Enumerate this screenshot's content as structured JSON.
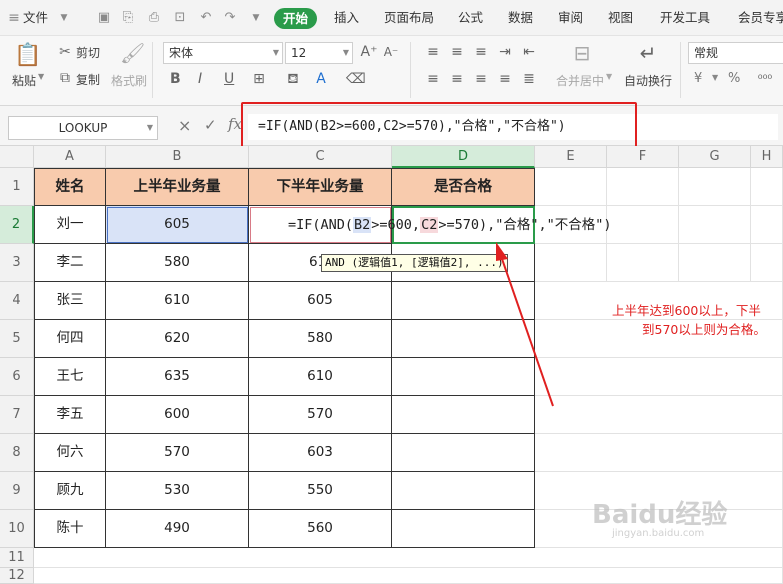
{
  "menu": {
    "file": "文件",
    "tabs": [
      "开始",
      "插入",
      "页面布局",
      "公式",
      "数据",
      "审阅",
      "视图",
      "开发工具",
      "会员专享"
    ]
  },
  "ribbon": {
    "paste": "粘贴",
    "cut": "剪切",
    "copy": "复制",
    "format_painter": "格式刷",
    "font_name": "宋体",
    "font_size": "12",
    "bold": "B",
    "italic": "I",
    "underline": "U",
    "merge_center": "合并居中",
    "wrap_text": "自动换行",
    "number_format": "常规",
    "currency": "¥",
    "percent": "%"
  },
  "formula_bar": {
    "name_box": "LOOKUP",
    "cancel": "×",
    "enter": "✓",
    "fx": "fx",
    "formula": "=IF(AND(B2>=600,C2>=570),\"合格\",\"不合格\")"
  },
  "columns": [
    "A",
    "B",
    "C",
    "D",
    "E",
    "F",
    "G",
    "H"
  ],
  "rows": [
    "1",
    "2",
    "3",
    "4",
    "5",
    "6",
    "7",
    "8",
    "9",
    "10",
    "11",
    "12"
  ],
  "table": {
    "headers": [
      "姓名",
      "上半年业务量",
      "下半年业务量",
      "是否合格"
    ],
    "rows": [
      [
        "刘一",
        "605",
        "",
        ""
      ],
      [
        "李二",
        "580",
        "61",
        ""
      ],
      [
        "张三",
        "610",
        "605",
        ""
      ],
      [
        "何四",
        "620",
        "580",
        ""
      ],
      [
        "王七",
        "635",
        "610",
        ""
      ],
      [
        "李五",
        "600",
        "570",
        ""
      ],
      [
        "何六",
        "570",
        "603",
        ""
      ],
      [
        "顾九",
        "530",
        "550",
        ""
      ],
      [
        "陈十",
        "490",
        "560",
        ""
      ]
    ]
  },
  "editing": {
    "p1": "=IF(AND(",
    "ref1": "B2",
    "p2": ">=600,",
    "ref2": "C2",
    "p3": ">=570),\"合格\",\"不合格\")",
    "tooltip": "AND (逻辑值1, [逻辑值2], ...)"
  },
  "note": {
    "line1": "上半年达到600以上，下半",
    "line2": "到570以上则为合格。"
  },
  "watermark": "Baidu经验 jingyan.baidu.com",
  "colors": {
    "accent": "#2a9b4a",
    "header_fill": "#f8cbad",
    "annotation_red": "#e02020",
    "selection_blue": "#d9e3f7"
  }
}
